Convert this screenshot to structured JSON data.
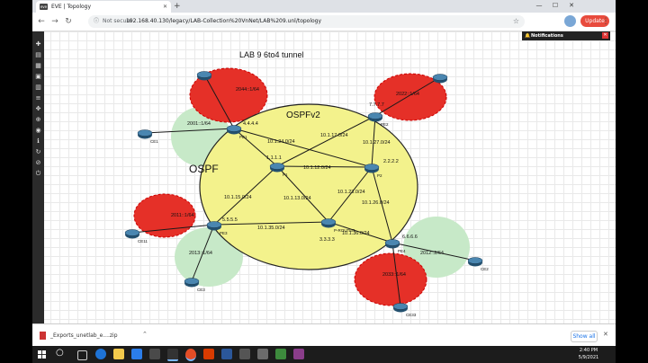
{
  "browser": {
    "tab_title": "EVE | Topology",
    "tab_favicon": "eve",
    "not_secure": "Not secure",
    "url": "192.168.40.130/legacy/LAB-Collection%20VnNet/LAB%209.unl/topology",
    "update_label": "Update"
  },
  "notifications": {
    "label": "Notifications"
  },
  "topology": {
    "title": "LAB 9 6to4 tunnel",
    "ospf_label": "OSPF",
    "ospfv2_label": "OSPFv2",
    "routers": {
      "pe1": {
        "name": "PE1",
        "id": "4.4.4.4"
      },
      "pe2": {
        "name": "PE2",
        "id": "7.7.7.7"
      },
      "p1": {
        "name": "P1",
        "id": "1.1.1.1"
      },
      "p2": {
        "name": "P2",
        "id": "2.2.2.2"
      },
      "pe3": {
        "name": "PE3",
        "id": "5.5.5.5"
      },
      "prouter": {
        "name": "P-ROUTER",
        "id": "3.3.3.3"
      },
      "pe4": {
        "name": "PE4",
        "id": "6.6.6.6"
      },
      "ce1": {
        "name": "CE1"
      },
      "ce2": {
        "name": "CE2"
      },
      "ce11": {
        "name": "CE11"
      },
      "ce3": {
        "name": "CE3"
      },
      "ce33": {
        "name": "CE33"
      },
      "ce4": {
        "name": "CE4"
      }
    },
    "subnets": {
      "s1": "10.1.24.0/24",
      "s2": "10.1.17.0/24",
      "s3": "10.1.27.0/24",
      "s4": "10.1.12.0/24",
      "s5": "10.1.15.0/24",
      "s6": "10.1.13.0/24",
      "s7": "10.1.23.0/24",
      "s8": "10.1.26.0/24",
      "s9": "10.1.35.0/24",
      "s10": "10.1.36.0/24"
    },
    "ipv6": {
      "a": "2044::1/64",
      "b": "2022::1/64",
      "c": "2001::1/64",
      "d": "2011::1/64",
      "e": "2013::1/64",
      "f": "2012::2/64",
      "g": "2033::1/64"
    }
  },
  "downloads": {
    "file": "_Exports_unetlab_e....zip",
    "show_all": "Show all"
  },
  "taskbar": {
    "time": "2:40 PM",
    "date": "5/9/2021"
  },
  "colors": {
    "ospf_area": "#f3f28c",
    "red_area": "#e53028",
    "green_area": "#c7e9c8",
    "router": "#2f5f82"
  }
}
